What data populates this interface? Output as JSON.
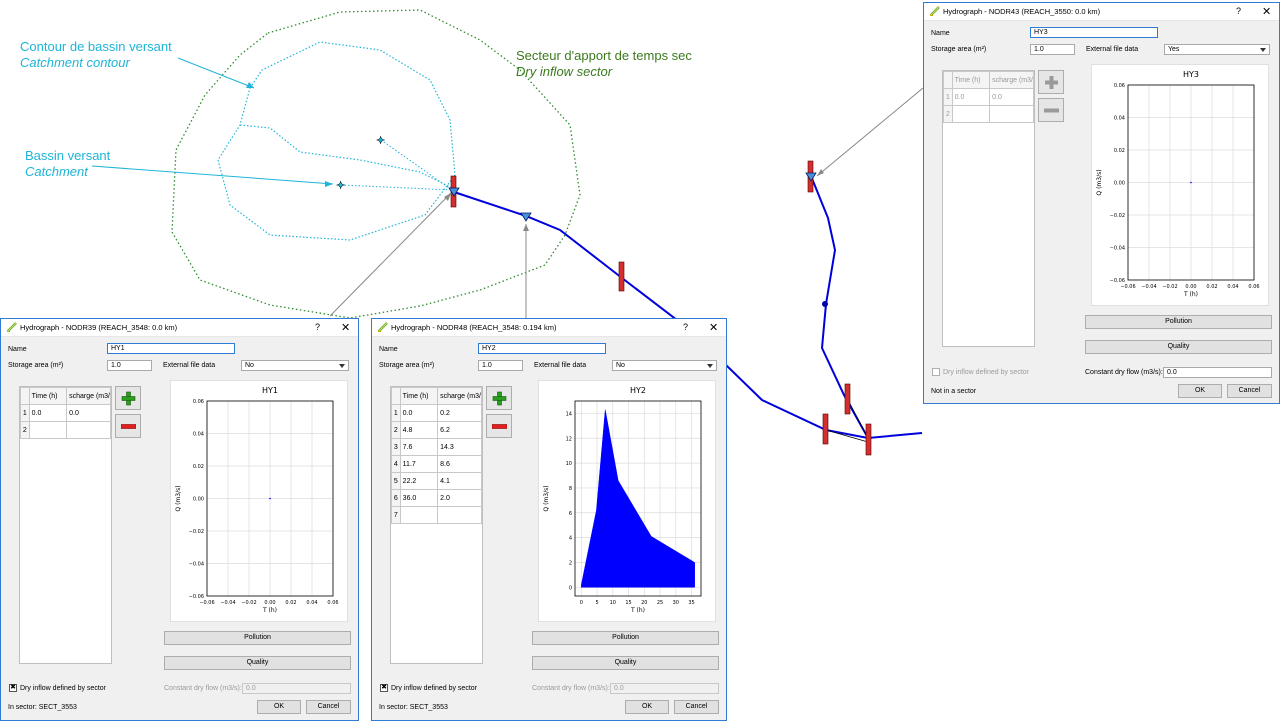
{
  "annotations": {
    "catchment_contour_fr": "Contour de bassin versant",
    "catchment_contour_en": "Catchment contour",
    "catchment_fr": "Bassin versant",
    "catchment_en": "Catchment",
    "dry_sector_fr": "Secteur d'apport de temps sec",
    "dry_sector_en": "Dry inflow sector"
  },
  "colors": {
    "reach": "#0000dd",
    "dialog_border": "#2f7bd6",
    "annotation_blue": "#1fb4d8",
    "annotation_green": "#3b7a1e",
    "marker_red": "#d32f2f",
    "hydrograph_fill": "#0000ff"
  },
  "dialogs": [
    {
      "id": "d1",
      "title": "Hydrograph - NODR39 (REACH_3548: 0.0 km)",
      "help": "?",
      "close": "✕",
      "name_label": "Name",
      "name_value": "HY1",
      "storage_label": "Storage area (m²)",
      "storage_value": "1.0",
      "external_label": "External file data",
      "external_value": "No",
      "table_headers": [
        "Time (h)",
        "scharge (m3/"
      ],
      "rows": [
        [
          "1",
          "0.0",
          "0.0"
        ],
        [
          "2",
          "",
          ""
        ]
      ],
      "add_icon": "plus-icon",
      "remove_icon": "minus-icon",
      "chart_title": "HY1",
      "pollution_label": "Pollution",
      "quality_label": "Quality",
      "dry_inflow_label": "Dry inflow defined by sector",
      "dry_inflow_checked": "✖",
      "constant_label": "Constant dry flow (m3/s):",
      "constant_value": "0.0",
      "sector_label": "In sector: SECT_3553",
      "ok_label": "OK",
      "cancel_label": "Cancel"
    },
    {
      "id": "d2",
      "title": "Hydrograph - NODR48 (REACH_3548: 0.194 km)",
      "help": "?",
      "close": "✕",
      "name_label": "Name",
      "name_value": "HY2",
      "storage_label": "Storage area (m²)",
      "storage_value": "1.0",
      "external_label": "External file data",
      "external_value": "No",
      "table_headers": [
        "Time (h)",
        "scharge (m3/"
      ],
      "rows": [
        [
          "1",
          "0.0",
          "0.2"
        ],
        [
          "2",
          "4.8",
          "6.2"
        ],
        [
          "3",
          "7.6",
          "14.3"
        ],
        [
          "4",
          "11.7",
          "8.6"
        ],
        [
          "5",
          "22.2",
          "4.1"
        ],
        [
          "6",
          "36.0",
          "2.0"
        ],
        [
          "7",
          "",
          ""
        ]
      ],
      "add_icon": "plus-icon",
      "remove_icon": "minus-icon",
      "chart_title": "HY2",
      "pollution_label": "Pollution",
      "quality_label": "Quality",
      "dry_inflow_label": "Dry inflow defined by sector",
      "dry_inflow_checked": "✖",
      "constant_label": "Constant dry flow (m3/s):",
      "constant_value": "0.0",
      "sector_label": "In sector: SECT_3553",
      "ok_label": "OK",
      "cancel_label": "Cancel"
    },
    {
      "id": "d3",
      "title": "Hydrograph - NODR43 (REACH_3550: 0.0 km)",
      "help": "?",
      "close": "✕",
      "name_label": "Name",
      "name_value": "HY3",
      "storage_label": "Storage area (m²)",
      "storage_value": "1.0",
      "external_label": "External file data",
      "external_value": "Yes",
      "table_headers": [
        "Time (h)",
        "scharge (m3/"
      ],
      "rows": [
        [
          "1",
          "0.0",
          "0.0"
        ],
        [
          "2",
          "",
          ""
        ]
      ],
      "add_icon": "plus-icon",
      "remove_icon": "minus-icon",
      "chart_title": "HY3",
      "pollution_label": "Pollution",
      "quality_label": "Quality",
      "dry_inflow_label": "Dry inflow defined by sector",
      "dry_inflow_checked": "",
      "constant_label": "Constant dry flow (m3/s):",
      "constant_value": "0.0",
      "sector_label": "Not in a sector",
      "ok_label": "OK",
      "cancel_label": "Cancel"
    }
  ],
  "chart_data": [
    {
      "type": "line",
      "title": "HY1",
      "xlabel": "T (h)",
      "ylabel": "Q (m3/s)",
      "x": [
        0.0
      ],
      "y": [
        0.0
      ],
      "xlim": [
        -0.06,
        0.06
      ],
      "ylim": [
        -0.06,
        0.06
      ],
      "xticks": [
        "−0.06",
        "−0.04",
        "−0.02",
        "0.00",
        "0.02",
        "0.04",
        "0.06"
      ],
      "yticks": [
        "−0.06",
        "−0.04",
        "−0.02",
        "0.00",
        "0.02",
        "0.04",
        "0.06"
      ],
      "grid": true
    },
    {
      "type": "area",
      "title": "HY2",
      "xlabel": "T (h)",
      "ylabel": "Q (m3/s)",
      "x": [
        0.0,
        4.8,
        7.6,
        11.7,
        22.2,
        36.0
      ],
      "y": [
        0.2,
        6.2,
        14.3,
        8.6,
        4.1,
        2.0
      ],
      "xlim": [
        -2,
        38
      ],
      "ylim": [
        -0.7,
        15
      ],
      "xticks": [
        "0",
        "5",
        "10",
        "15",
        "20",
        "25",
        "30",
        "35"
      ],
      "yticks": [
        "0",
        "2",
        "4",
        "6",
        "8",
        "10",
        "12",
        "14"
      ],
      "grid": true
    },
    {
      "type": "line",
      "title": "HY3",
      "xlabel": "T (h)",
      "ylabel": "Q (m3/s)",
      "x": [
        0.0
      ],
      "y": [
        0.0
      ],
      "xlim": [
        -0.06,
        0.06
      ],
      "ylim": [
        -0.06,
        0.06
      ],
      "xticks": [
        "−0.06",
        "−0.04",
        "−0.02",
        "0.00",
        "0.02",
        "0.04",
        "0.06"
      ],
      "yticks": [
        "−0.06",
        "−0.04",
        "−0.02",
        "0.00",
        "0.02",
        "0.04",
        "0.06"
      ],
      "grid": true
    }
  ]
}
